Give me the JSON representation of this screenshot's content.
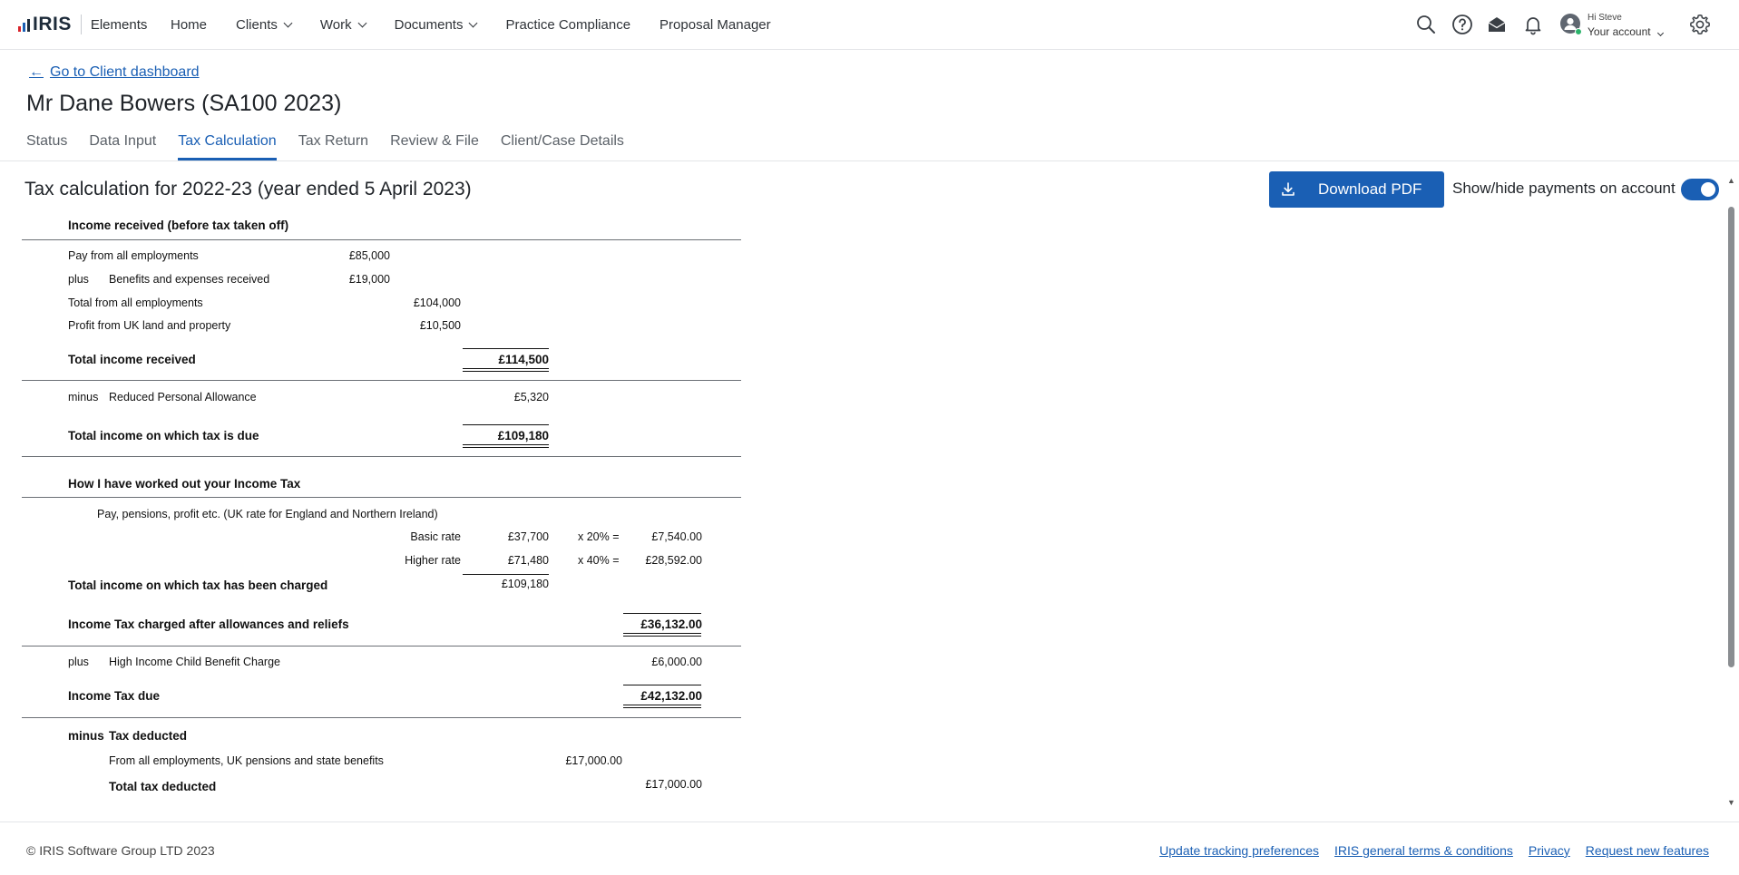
{
  "app": {
    "logo_text": "IRIS",
    "product_name": "Elements",
    "logo_bar_colors": [
      "#d8232a",
      "#1a5fb4",
      "#1d2b3a"
    ]
  },
  "nav": {
    "home": "Home",
    "clients": "Clients",
    "work": "Work",
    "documents": "Documents",
    "practice_compliance": "Practice Compliance",
    "proposal_manager": "Proposal Manager"
  },
  "header_icons": [
    "search-icon",
    "help-icon",
    "mail-icon",
    "bell-icon",
    "settings-icon"
  ],
  "account": {
    "greeting": "Hi Steve",
    "label": "Your account",
    "status_color": "#2bb36a"
  },
  "page": {
    "back_link": "Go to Client dashboard",
    "title": "Mr Dane Bowers (SA100 2023)",
    "tabs": [
      {
        "label": "Status"
      },
      {
        "label": "Data Input"
      },
      {
        "label": "Tax Calculation",
        "active": true
      },
      {
        "label": "Tax Return"
      },
      {
        "label": "Review & File"
      },
      {
        "label": "Client/Case Details"
      }
    ]
  },
  "calc": {
    "title": "Tax calculation for 2022-23 (year ended 5 April 2023)",
    "download_label": "Download PDF",
    "toggle_label": "Show/hide payments on account",
    "toggle_on": true,
    "accent": "#1a5fb4",
    "income_heading": "Income received (before tax taken off)",
    "pay_label": "Pay from all employments",
    "pay_value": "£85,000",
    "plus_word": "plus",
    "benefits_label": "Benefits and expenses received",
    "benefits_value": "£19,000",
    "total_employments_label": "Total from all employments",
    "total_employments_value": "£104,000",
    "property_label": "Profit from UK land and property",
    "property_value": "£10,500",
    "total_income_label": "Total income received",
    "total_income_value": "£114,500",
    "minus_word": "minus",
    "allowance_label": "Reduced Personal Allowance",
    "allowance_value": "£5,320",
    "taxable_label": "Total income on which tax is due",
    "taxable_value": "£109,180",
    "worked_heading": "How I have worked out your Income Tax",
    "rate_note": "Pay, pensions, profit etc. (UK rate for England and Northern Ireland)",
    "basic_label": "Basic rate",
    "basic_amount": "£37,700",
    "basic_rate": "x 20% =",
    "basic_tax": "£7,540.00",
    "higher_label": "Higher rate",
    "higher_amount": "£71,480",
    "higher_rate": "x 40% =",
    "higher_tax": "£28,592.00",
    "charged_label": "Total income on which tax has been charged",
    "charged_value": "£109,180",
    "after_allowances_label": "Income Tax charged after allowances and reliefs",
    "after_allowances_value": "£36,132.00",
    "hicbc_label": "High Income Child Benefit Charge",
    "hicbc_value": "£6,000.00",
    "tax_due_label": "Income Tax due",
    "tax_due_value": "£42,132.00",
    "deducted_minus": "minus",
    "deducted_heading": "Tax deducted",
    "deducted_row_label": "From all employments, UK pensions and state benefits",
    "deducted_row_value": "£17,000.00",
    "total_deducted_label": "Total tax deducted",
    "total_deducted_value": "£17,000.00"
  },
  "footer": {
    "copyright": "© IRIS Software Group LTD 2023",
    "links": [
      "Update tracking preferences",
      "IRIS general terms & conditions",
      "Privacy",
      "Request new features"
    ]
  }
}
